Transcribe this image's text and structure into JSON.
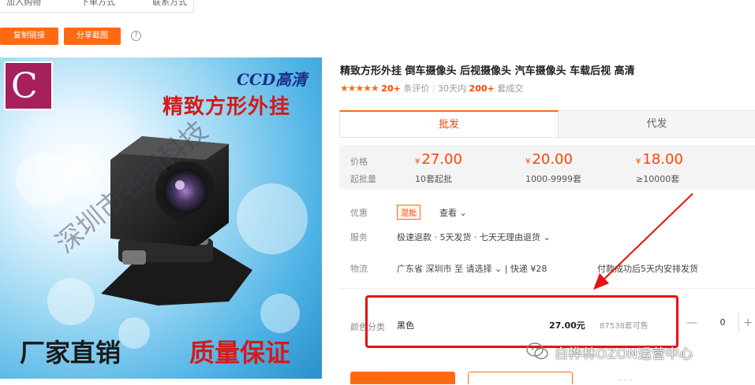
{
  "nav": {
    "items": [
      "加入购物",
      "下单方式",
      "联系方式"
    ]
  },
  "actions": {
    "copy_link": "复制链接",
    "share_screenshot": "分享截图",
    "help": "?"
  },
  "product_image": {
    "logo": "C",
    "ccd": "CCD高清",
    "headline": "精致方形外挂",
    "watermark": "深圳市名明科技",
    "slogan_left": "厂家直销",
    "slogan_right": "质量保证"
  },
  "product": {
    "title": "精致方形外挂 倒车摄像头 后视摄像头 汽车摄像头 车载后视 高清",
    "stars": "★★★★★",
    "reviews_count": "20+",
    "reviews_label": "条评价",
    "sales_prefix": "30天内",
    "sales_count": "200+",
    "sales_label": "套成交"
  },
  "tabs": {
    "wholesale": "批发",
    "dropship": "代发"
  },
  "pricing": {
    "price_label": "价格",
    "moq_label": "起批量",
    "currency": "¥",
    "tiers": [
      {
        "price": "27.00",
        "range": "10套起批"
      },
      {
        "price": "20.00",
        "range": "1000-9999套"
      },
      {
        "price": "18.00",
        "range": "≥10000套"
      }
    ]
  },
  "details": {
    "promo_label": "优惠",
    "promo_tag": "混批",
    "promo_value": "查看 ⌄",
    "service_label": "服务",
    "service_value": "极速退款 · 5天发货 · 七天无理由退货 ⌄",
    "logistics_label": "物流",
    "logistics_value": "广东省 深圳市  至  请选择 ⌄  |  快递  ¥28",
    "delivery_note": "付款成功后5天内安排发货"
  },
  "variant": {
    "label": "颜色分类",
    "name": "黑色",
    "price": "27.00元",
    "stock": "87538套可售",
    "qty": "0",
    "minus": "—",
    "plus": "+"
  },
  "watermark": {
    "text": "白桦林OZON运营中心"
  },
  "footer": {
    "more": "· · ·"
  }
}
